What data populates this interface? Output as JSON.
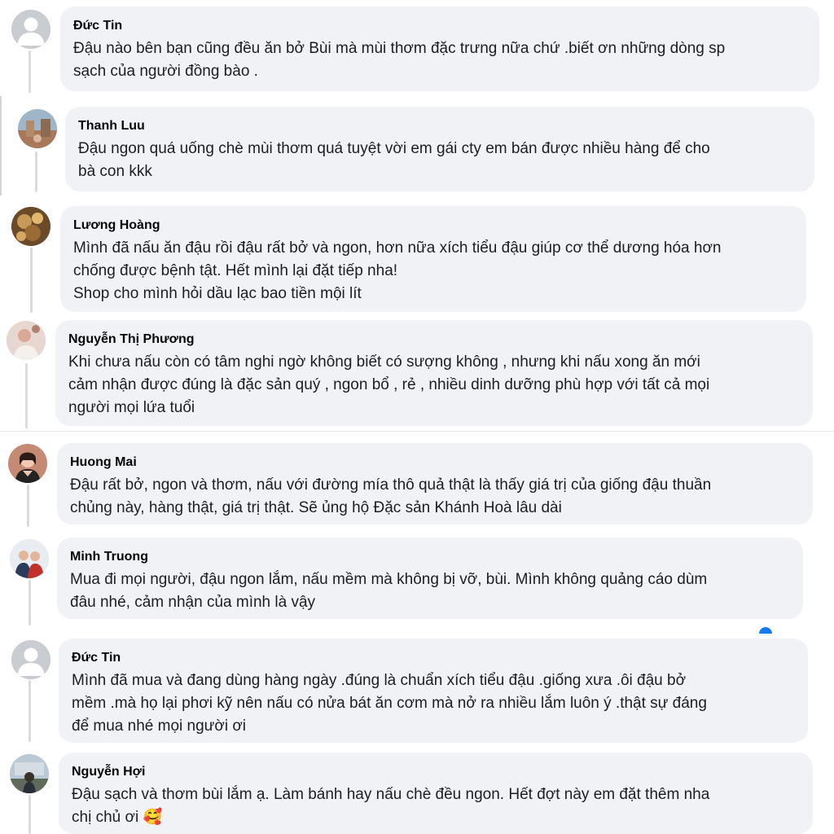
{
  "comments": [
    {
      "author": "Đức Tin",
      "text": "Đậu nào bên bạn cũng đều ăn bở Bùi mà mùi thơm đặc trưng nữa chứ .biết ơn những dòng sp\nsạch của người đồng bào ."
    },
    {
      "author": "Thanh Luu",
      "text": "Đậu ngon quá uống chè mùi thơm quá tuyệt vời em gái cty em bán được nhiều hàng để cho\nbà con kkk"
    },
    {
      "author": "Lương Hoàng",
      "text": "Mình đã nấu ăn đậu rồi đậu rất bở và ngon, hơn nữa xích tiểu đậu giúp cơ thể dương hóa hơn\nchống được bệnh tật. Hết mình lại đặt tiếp nha!\nShop cho mình hỏi dầu lạc bao tiền mội lít"
    },
    {
      "author": "Nguyễn Thị Phương",
      "text": "Khi chưa nấu còn có tâm nghi ngờ không biết có sượng không , nhưng khi nấu xong ăn mới\ncảm nhận được đúng là đặc sản quý , ngon bổ , rẻ , nhiều dinh dưỡng phù hợp với tất cả mọi\nngười mọi lứa tuổi"
    },
    {
      "author": "Huong Mai",
      "text": "Đậu rất bở, ngon và thơm, nấu với đường mía thô quả thật là thấy giá trị của giống đậu thuần\nchủng này, hàng thật, giá trị thật. Sẽ ủng hộ Đặc sản Khánh Hoà lâu dài"
    },
    {
      "author": "Minh Truong",
      "text": "Mua đi mọi người, đậu ngon lắm, nấu mềm mà không bị vỡ, bùi. Mình không quảng cáo dùm\nđâu nhé, cảm nhận của mình là vậy"
    },
    {
      "author": "Đức Tin",
      "text": "Mình đã mua và đang dùng hàng ngày .đúng là chuẩn xích tiểu đậu .giống xưa .ôi đậu bở\nmềm .mà họ lại phơi kỹ nên nấu có nửa bát ăn cơm mà nở ra nhiều lắm luôn ý .thật sự đáng\nđể mua nhé mọi người ơi"
    },
    {
      "author": "Nguyễn Hợi",
      "text": "Đậu sạch và thơm bùi lắm ạ. Làm bánh hay nấu chè đều ngon. Hết đợt này em đặt thêm nha\nchị chủ ơi",
      "emoji": "🥰"
    }
  ],
  "colors": {
    "bubble": "#f0f2f5",
    "author": "#050505",
    "text": "#1c1e21",
    "reaction_like": "#1877f2",
    "reaction_love": "#f33e58"
  }
}
